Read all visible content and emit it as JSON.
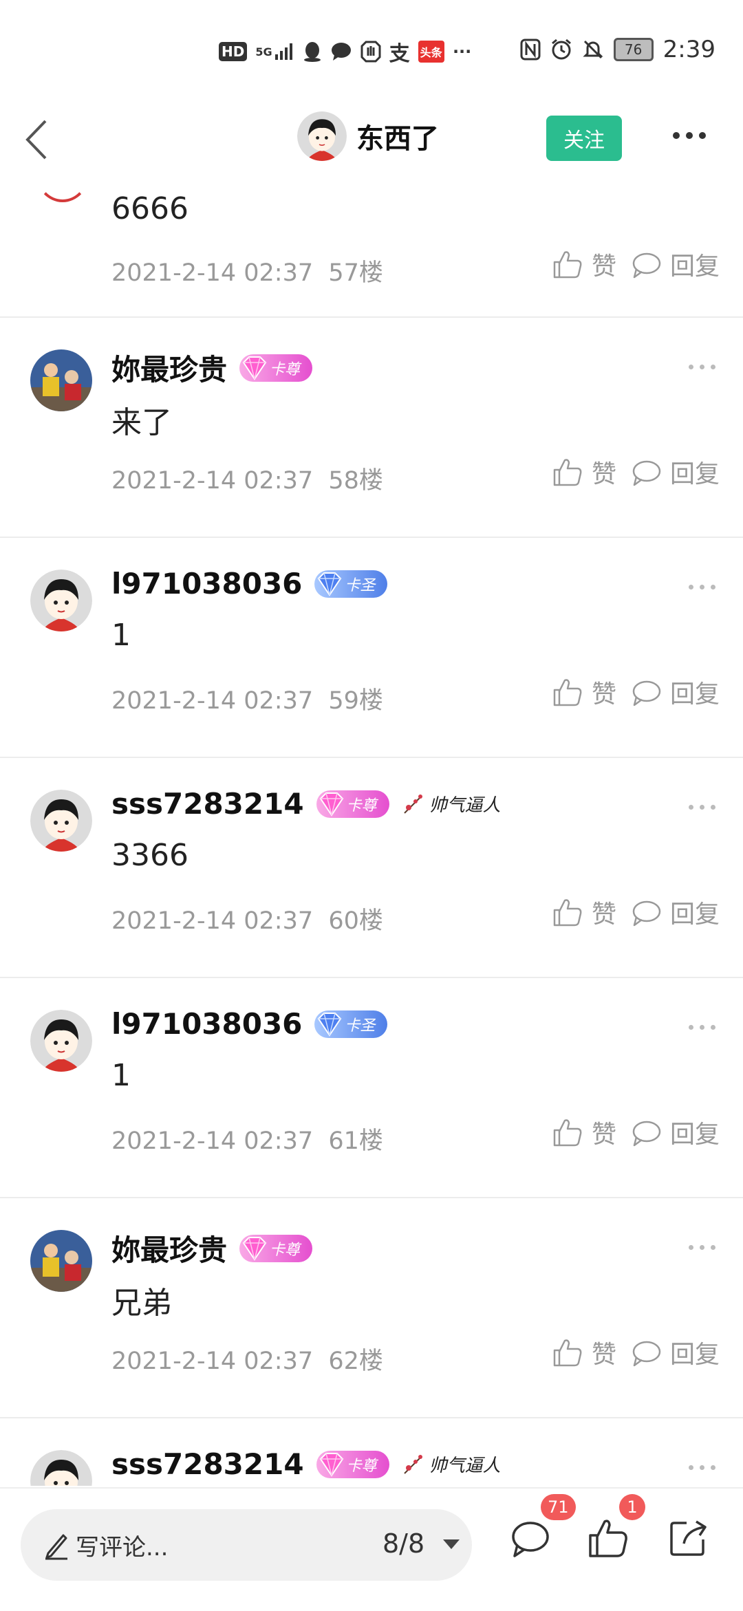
{
  "status_bar": {
    "left_icons": [
      "hd-icon",
      "signal-5g-icon",
      "qq-icon",
      "message-icon",
      "hand-icon",
      "alipay-icon",
      "toutiao-icon",
      "overflow-icon"
    ],
    "hd": "HD",
    "net": "5G",
    "alipay": "支",
    "toutiao": "头条",
    "overflow": "···",
    "battery": "76",
    "time": "2:39"
  },
  "header": {
    "title": "东西了",
    "follow_label": "关注"
  },
  "first_comment": {
    "text": "6666",
    "timestamp": "2021-2-14 02:37",
    "floor": "57楼",
    "like_label": "赞",
    "reply_label": "回复"
  },
  "comments": [
    {
      "username": "妳最珍贵",
      "avatar": "kids-photo",
      "badge": "卡尊",
      "badge_color": "#e54fcf",
      "tag": "",
      "text": "来了",
      "timestamp": "2021-2-14 02:37",
      "floor": "58楼",
      "like_label": "赞",
      "reply_label": "回复"
    },
    {
      "username": "l971038036",
      "avatar": "cartoon-girl",
      "badge": "卡圣",
      "badge_color": "#4f7fe8",
      "tag": "",
      "text": "1",
      "timestamp": "2021-2-14 02:37",
      "floor": "59楼",
      "like_label": "赞",
      "reply_label": "回复"
    },
    {
      "username": "sss7283214",
      "avatar": "cartoon-girl",
      "badge": "卡尊",
      "badge_color": "#e54fcf",
      "tag": "帅气逼人",
      "text": "3366",
      "timestamp": "2021-2-14 02:37",
      "floor": "60楼",
      "like_label": "赞",
      "reply_label": "回复"
    },
    {
      "username": "l971038036",
      "avatar": "cartoon-girl",
      "badge": "卡圣",
      "badge_color": "#4f7fe8",
      "tag": "",
      "text": "1",
      "timestamp": "2021-2-14 02:37",
      "floor": "61楼",
      "like_label": "赞",
      "reply_label": "回复"
    },
    {
      "username": "妳最珍贵",
      "avatar": "kids-photo",
      "badge": "卡尊",
      "badge_color": "#e54fcf",
      "tag": "",
      "text": "兄弟",
      "timestamp": "2021-2-14 02:37",
      "floor": "62楼",
      "like_label": "赞",
      "reply_label": "回复"
    },
    {
      "username": "sss7283214",
      "avatar": "cartoon-girl",
      "badge": "卡尊",
      "badge_color": "#e54fcf",
      "tag": "帅气逼人",
      "text": "",
      "timestamp": "",
      "floor": "",
      "like_label": "",
      "reply_label": ""
    }
  ],
  "bottom_bar": {
    "placeholder": "写评论...",
    "page": "8/8",
    "comment_count": "71",
    "like_count": "1"
  },
  "colors": {
    "accent": "#2bbd8f",
    "badge_red": "#f15a5a",
    "meta_gray": "#999999"
  }
}
